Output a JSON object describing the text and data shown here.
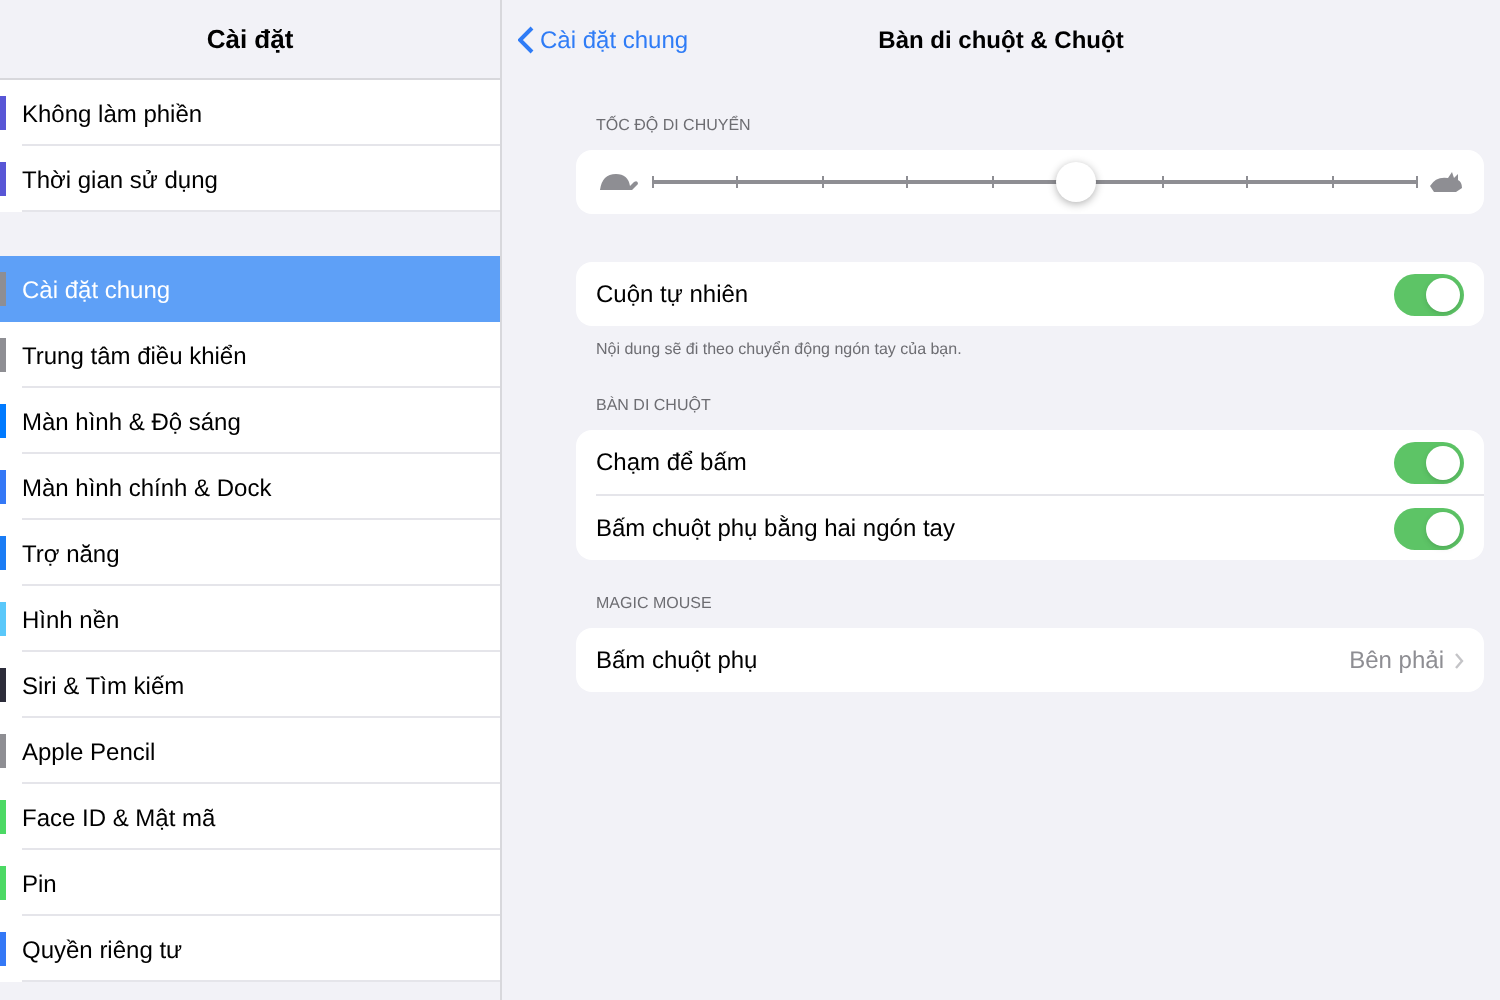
{
  "sidebar": {
    "title": "Cài đặt",
    "groups": [
      {
        "items": [
          {
            "label": "Không làm phiền",
            "selected": false,
            "color": "#5856d6"
          },
          {
            "label": "Thời gian sử dụng",
            "selected": false,
            "color": "#5856d6"
          }
        ]
      },
      {
        "items": [
          {
            "label": "Cài đặt chung",
            "selected": true,
            "color": "#8e8e93"
          },
          {
            "label": "Trung tâm điều khiển",
            "selected": false,
            "color": "#8e8e93"
          },
          {
            "label": "Màn hình & Độ sáng",
            "selected": false,
            "color": "#007aff"
          },
          {
            "label": "Màn hình chính & Dock",
            "selected": false,
            "color": "#3478f6"
          },
          {
            "label": "Trợ năng",
            "selected": false,
            "color": "#1a7cf5"
          },
          {
            "label": "Hình nền",
            "selected": false,
            "color": "#5ac8fa"
          },
          {
            "label": "Siri & Tìm kiếm",
            "selected": false,
            "color": "#2c2c3a"
          },
          {
            "label": "Apple Pencil",
            "selected": false,
            "color": "#8e8e93"
          },
          {
            "label": "Face ID & Mật mã",
            "selected": false,
            "color": "#4cd964"
          },
          {
            "label": "Pin",
            "selected": false,
            "color": "#4cd964"
          },
          {
            "label": "Quyền riêng tư",
            "selected": false,
            "color": "#3478f6"
          }
        ]
      }
    ]
  },
  "detail": {
    "back": "Cài đặt chung",
    "title": "Bàn di chuột & Chuột",
    "sections": [
      {
        "header": "TỐC ĐỘ DI CHUYỂN",
        "rows": [
          {
            "kind": "slider",
            "level": 0.556
          }
        ]
      },
      {
        "rows": [
          {
            "kind": "toggle",
            "label": "Cuộn tự nhiên",
            "on": true
          }
        ],
        "footer": "Nội dung sẽ đi theo chuyển động ngón tay của bạn."
      },
      {
        "header": "BÀN DI CHUỘT",
        "rows": [
          {
            "kind": "toggle",
            "label": "Chạm để bấm",
            "on": true
          },
          {
            "kind": "toggle",
            "label": "Bấm chuột phụ bằng hai ngón tay",
            "on": true
          }
        ]
      },
      {
        "header": "MAGIC MOUSE",
        "rows": [
          {
            "kind": "link",
            "label": "Bấm chuột phụ",
            "value": "Bên phải"
          }
        ]
      }
    ]
  }
}
